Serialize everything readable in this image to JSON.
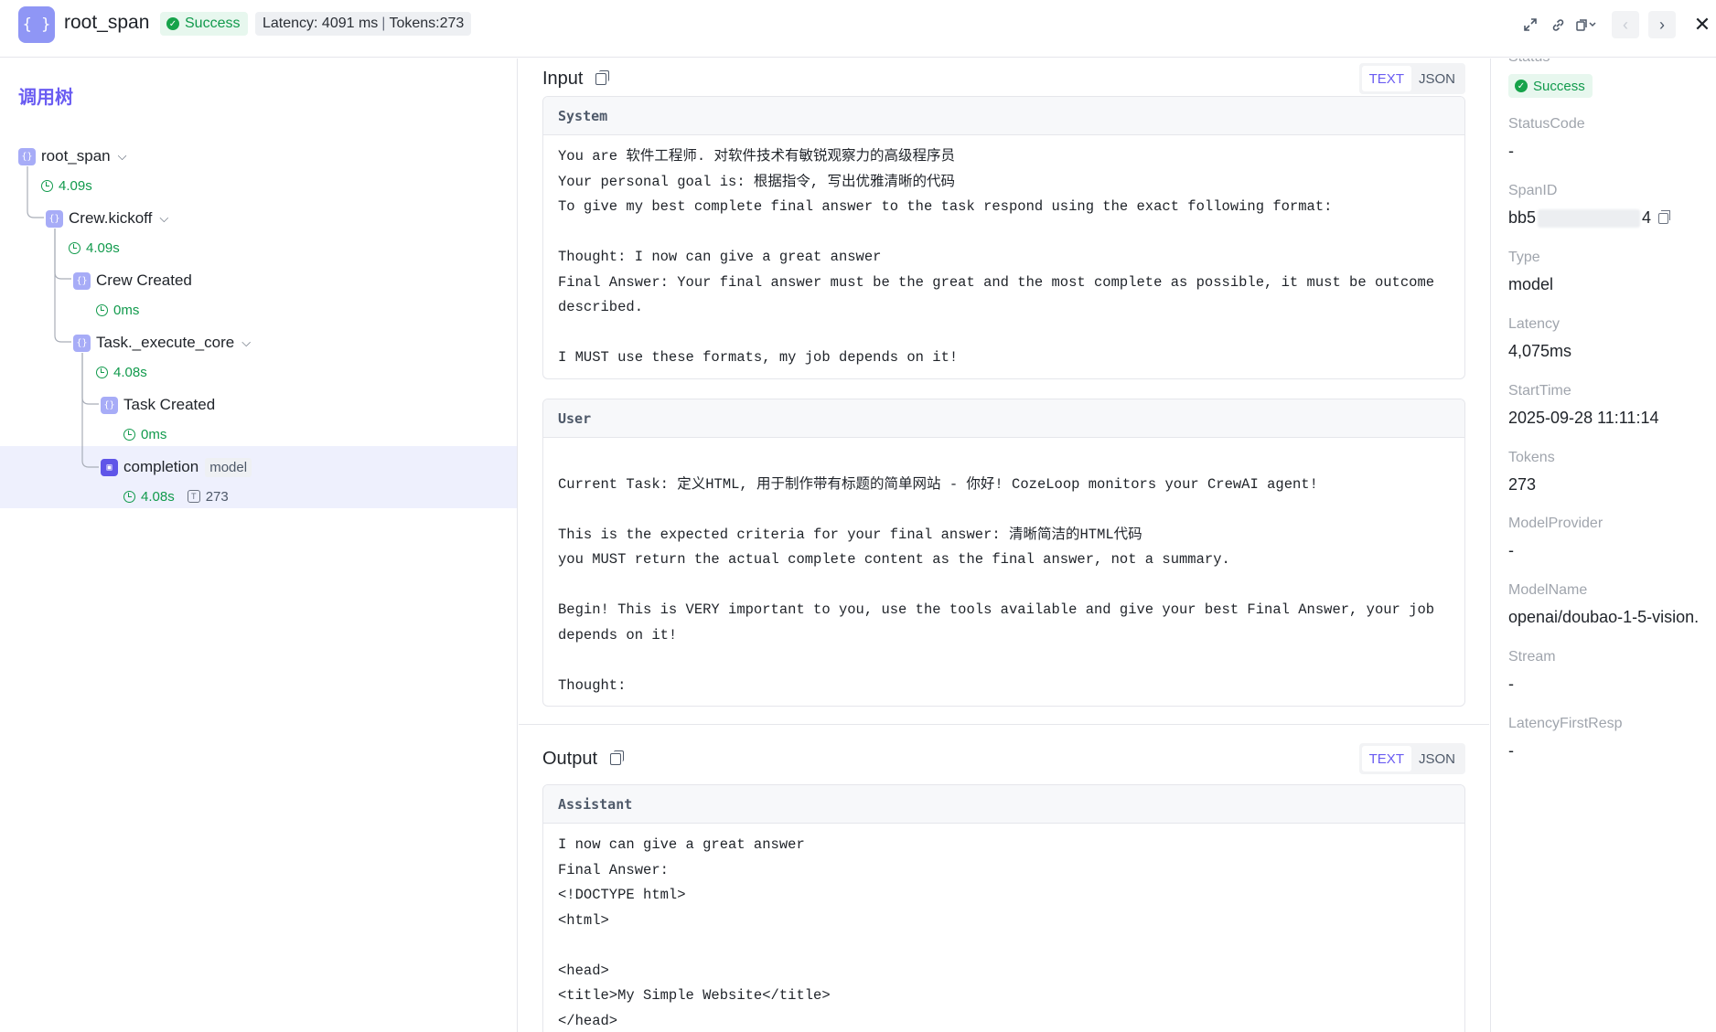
{
  "header": {
    "icon_glyph": "{ }",
    "title": "root_span",
    "status": "Success",
    "latency": "Latency: 4091 ms",
    "tokens": "Tokens:273",
    "separator": "|",
    "icons": [
      "expand-icon",
      "link-icon",
      "copy-dropdown-icon",
      "chevron-left-icon",
      "chevron-right-icon",
      "close-icon"
    ]
  },
  "tree": {
    "title": "调用树",
    "nodes": [
      {
        "label": "root_span",
        "duration": "4.09s"
      },
      {
        "label": "Crew.kickoff",
        "duration": "4.09s"
      },
      {
        "label": "Crew Created",
        "duration": "0ms"
      },
      {
        "label": "Task._execute_core",
        "duration": "4.08s"
      },
      {
        "label": "Task Created",
        "duration": "0ms"
      },
      {
        "label": "completion",
        "tag": "model",
        "duration": "4.08s",
        "tokens": "273"
      }
    ]
  },
  "input": {
    "title": "Input",
    "seg_text": "TEXT",
    "seg_json": "JSON",
    "system_role": "System",
    "system_lines": [
      "You are 软件工程师. 对软件技术有敏锐观察力的高级程序员",
      "Your personal goal is: 根据指令, 写出优雅清晰的代码",
      "To give my best complete final answer to the task respond using the exact following format:",
      "",
      "Thought: I now can give a great answer",
      "Final Answer: Your final answer must be the great and the most complete as possible, it must be outcome",
      "described.",
      "",
      "I MUST use these formats, my job depends on it!"
    ],
    "user_role": "User",
    "user_lines": [
      "",
      "Current Task: 定义HTML, 用于制作带有标题的简单网站 - 你好! CozeLoop monitors your CrewAI agent!",
      "",
      "This is the expected criteria for your final answer: 清晰简洁的HTML代码",
      "you MUST return the actual complete content as the final answer, not a summary.",
      "",
      "Begin! This is VERY important to you, use the tools available and give your best Final Answer, your job",
      "depends on it!",
      "",
      "Thought:"
    ]
  },
  "output": {
    "title": "Output",
    "seg_text": "TEXT",
    "seg_json": "JSON",
    "assistant_role": "Assistant",
    "assistant_lines": [
      "I now can give a great answer",
      "Final Answer:",
      "<!DOCTYPE html>",
      "<html>",
      "",
      "<head>",
      "<title>My Simple Website</title>",
      "</head>"
    ]
  },
  "details": {
    "status_label": "Status",
    "status_value": "Success",
    "status_code_label": "StatusCode",
    "status_code_value": "-",
    "span_id_label": "SpanID",
    "span_id_prefix": "bb5",
    "span_id_suffix": "4",
    "type_label": "Type",
    "type_value": "model",
    "latency_label": "Latency",
    "latency_value": "4,075ms",
    "start_time_label": "StartTime",
    "start_time_value": "2025-09-28 11:11:14",
    "tokens_label": "Tokens",
    "tokens_value": "273",
    "model_provider_label": "ModelProvider",
    "model_provider_value": "-",
    "model_name_label": "ModelName",
    "model_name_value": "openai/doubao-1-5-vision.",
    "stream_label": "Stream",
    "stream_value": "-",
    "latency_first_label": "LatencyFirstResp",
    "latency_first_value": "-"
  }
}
